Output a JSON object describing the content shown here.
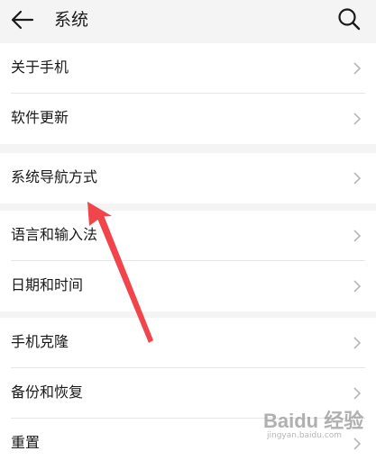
{
  "header": {
    "title": "系统",
    "back_icon": "arrow-left-icon",
    "search_icon": "search-icon"
  },
  "groups": [
    {
      "items": [
        {
          "label": "关于手机"
        },
        {
          "label": "软件更新"
        }
      ]
    },
    {
      "items": [
        {
          "label": "系统导航方式"
        }
      ]
    },
    {
      "items": [
        {
          "label": "语言和输入法"
        },
        {
          "label": "日期和时间"
        }
      ]
    },
    {
      "items": [
        {
          "label": "手机克隆"
        },
        {
          "label": "备份和恢复"
        },
        {
          "label": "重置"
        }
      ]
    }
  ],
  "annotation": {
    "arrow_color": "#f0464b"
  },
  "watermark": {
    "text": "Baidu 经验",
    "sub": "jingyan.baidu.com"
  }
}
